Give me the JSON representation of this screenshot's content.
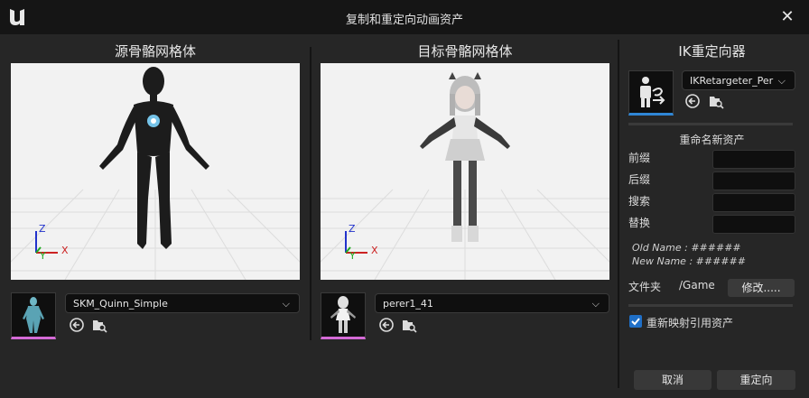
{
  "window": {
    "title": "复制和重定向动画资产",
    "close_glyph": "✕"
  },
  "source": {
    "heading": "源骨骼网格体",
    "asset": "SKM_Quinn_Simple",
    "axes": {
      "z": "Z",
      "y": "Y",
      "x": "X"
    }
  },
  "target": {
    "heading": "目标骨骼网格体",
    "asset": "perer1_41",
    "axes": {
      "z": "Z",
      "y": "Y",
      "x": "X"
    }
  },
  "retargeter": {
    "heading": "IK重定向器",
    "asset": "IKRetargeter_Per"
  },
  "rename": {
    "heading": "重命名新资产",
    "prefix_label": "前缀",
    "suffix_label": "后缀",
    "search_label": "搜索",
    "replace_label": "替换",
    "prefix_value": "",
    "suffix_value": "",
    "search_value": "",
    "replace_value": "",
    "old_name": "Old Name : ######",
    "new_name": "New Name : ######"
  },
  "folder": {
    "label": "文件夹",
    "path": "/Game",
    "change_label": "修改....."
  },
  "remap": {
    "label": "重新映射引用资产",
    "checked": true
  },
  "buttons": {
    "cancel": "取消",
    "retarget": "重定向"
  },
  "icons": [
    "unreal-logo-icon",
    "close-icon",
    "chevron-down-icon",
    "browse-arrow-icon",
    "find-folder-icon",
    "retarget-person-icon"
  ],
  "colors": {
    "accent_pink": "#d46ad6",
    "accent_blue": "#2f86d6",
    "checkbox": "#1f6fc7"
  }
}
